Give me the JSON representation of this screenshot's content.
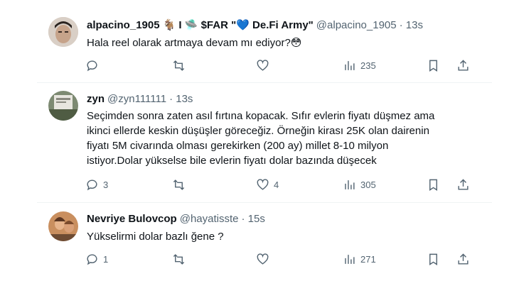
{
  "tweets": [
    {
      "name": "alpacino_1905",
      "name_decor": "🐐 I 🛸 $FAR \"💙 De.Fi Army\"",
      "handle": "@alpacino_1905",
      "time": "· 13s",
      "text": "Hala reel olarak artmaya devam mı ediyor?😳",
      "replies": "",
      "retweets": "",
      "likes": "",
      "views": "235"
    },
    {
      "name": "zyn",
      "name_decor": "",
      "handle": "@zyn111111",
      "time": "· 13s",
      "text_lines": [
        "Seçimden sonra zaten asıl fırtına kopacak. Sıfır evlerin fiyatı düşmez ama",
        "ikinci ellerde keskin düşüşler göreceğiz. Örneğin kirası 25K olan dairenin",
        "fiyatı 5M civarında olması gerekirken (200 ay) millet 8-10 milyon",
        "istiyor.Dolar yükselse bile evlerin fiyatı dolar bazında düşecek"
      ],
      "replies": "3",
      "retweets": "",
      "likes": "4",
      "views": "305"
    },
    {
      "name": "Nevriye Bulovcop",
      "name_decor": "",
      "handle": "@hayatisste",
      "time": "· 15s",
      "text": "Yükselirmi dolar bazlı ğene ?",
      "replies": "1",
      "retweets": "",
      "likes": "",
      "views": "271"
    }
  ]
}
